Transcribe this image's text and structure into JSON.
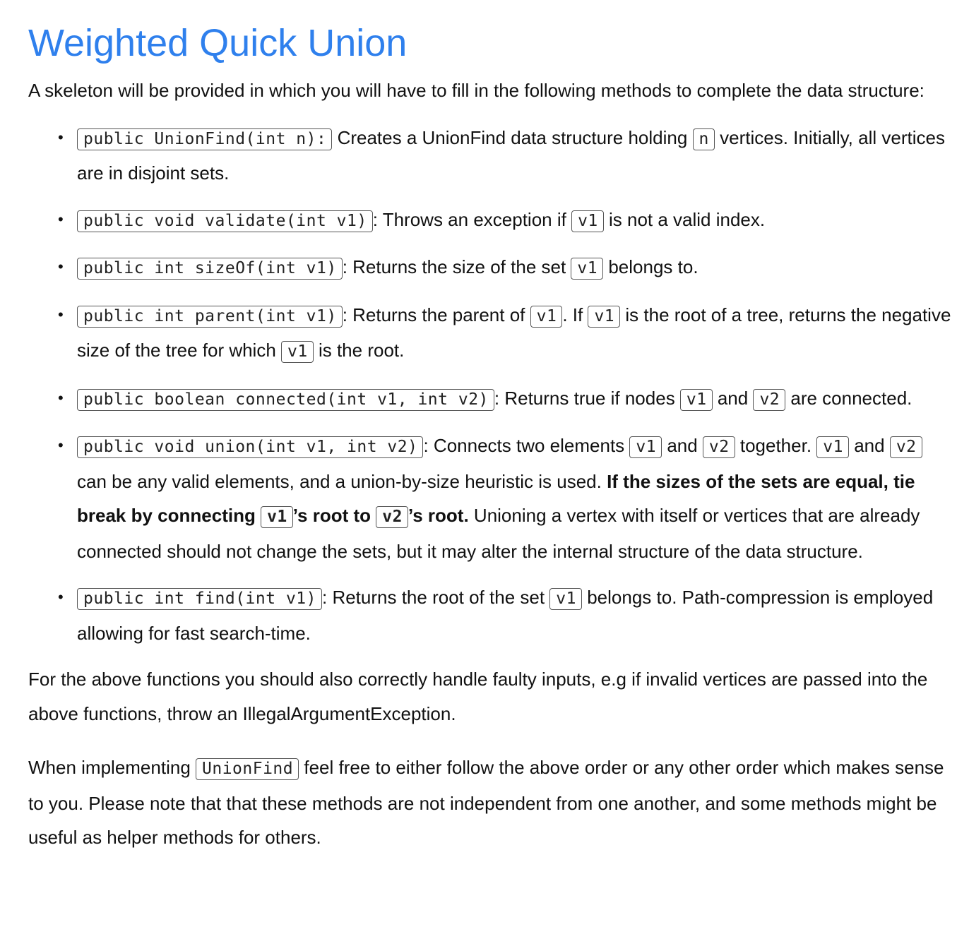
{
  "title": "Weighted Quick Union",
  "intro": "A skeleton will be provided in which you will have to fill in the following methods to complete the data structure:",
  "methods": [
    {
      "sig": "public UnionFind(int n):",
      "t1": " Creates a UnionFind data structure holding ",
      "c1": "n",
      "t2": " vertices. Initially, all vertices are in disjoint sets."
    },
    {
      "sig": "public void validate(int v1)",
      "t1": ": Throws an exception if ",
      "c1": "v1",
      "t2": " is not a valid index."
    },
    {
      "sig": "public int sizeOf(int v1)",
      "t1": ": Returns the size of the set ",
      "c1": "v1",
      "t2": " belongs to."
    },
    {
      "sig": "public int parent(int v1)",
      "t1": ": Returns the parent of ",
      "c1": "v1",
      "t2": ". If ",
      "c2": "v1",
      "t3": " is the root of a tree, returns the negative size of the tree for which ",
      "c3": "v1",
      "t4": " is the root."
    },
    {
      "sig": "public boolean connected(int v1, int v2)",
      "t1": ": Returns true if nodes ",
      "c1": "v1",
      "t2": " and ",
      "c2": "v2",
      "t3": " are connected."
    },
    {
      "sig": "public void union(int v1, int v2)",
      "t1": ": Connects two elements ",
      "c1": "v1",
      "t2": " and ",
      "c2": "v2",
      "t3": " together. ",
      "c3": "v1",
      "t4": " and ",
      "c4": "v2",
      "t5": " can be any valid elements, and a union-by-size heuristic is used. ",
      "b1": "If the sizes of the sets are equal, tie break by connecting ",
      "bc1": "v1",
      "b2": "’s root to ",
      "bc2": "v2",
      "b3": "’s root.",
      "t6": " Unioning a vertex with itself or vertices that are already connected should not change the sets, but it may alter the internal structure of the data structure."
    },
    {
      "sig": "public int find(int v1)",
      "t1": ": Returns the root of the set ",
      "c1": "v1",
      "t2": " belongs to. Path-compression is employed allowing for fast search-time."
    }
  ],
  "para_faulty": "For the above functions you should also correctly handle faulty inputs, e.g if invalid vertices are passed into the above functions, throw an IllegalArgumentException.",
  "para_last": {
    "t1": "When implementing ",
    "c1": "UnionFind",
    "t2": " feel free to either follow the above order or any other order which makes sense to you. Please note that that these methods are not independent from one another, and some methods might be useful as helper methods for others."
  },
  "bullet_glyph": "•"
}
